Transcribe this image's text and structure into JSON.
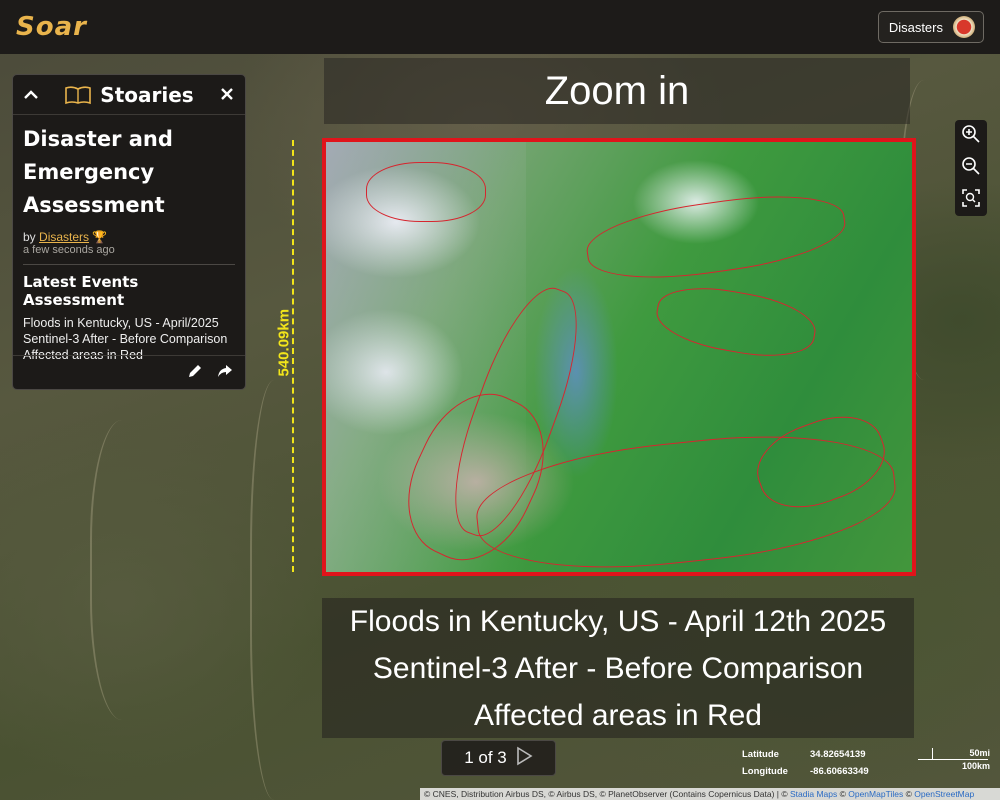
{
  "header": {
    "logo": "Soar",
    "category_button": {
      "label": "Disasters",
      "icon": "disasters-badge-icon"
    }
  },
  "panel": {
    "title": "Stoaries",
    "story_title_lines": [
      "Disaster and",
      "Emergency",
      "Assessment"
    ],
    "by_label": "by",
    "author": "Disasters",
    "timestamp": "a few seconds ago",
    "section_title": "Latest Events Assessment",
    "description_lines": [
      "Floods in Kentucky, US - April/2025",
      "Sentinel-3 After - Before Comparison",
      "Affected areas in Red"
    ]
  },
  "map": {
    "zoom_header": "Zoom in",
    "scale_label": "540.09km",
    "caption_lines": [
      "Floods in Kentucky, US - April 12th 2025",
      "Sentinel-3 After - Before Comparison",
      "Affected areas in Red"
    ],
    "highlight_color": "#e0141b",
    "scale_color": "#f2e51a"
  },
  "pagination": {
    "label": "1 of 3"
  },
  "coordinates": {
    "latitude_label": "Latitude",
    "latitude": "34.82654139",
    "longitude_label": "Longitude",
    "longitude": "-86.60663349"
  },
  "scalebar": {
    "top": "50mi",
    "bottom": "100km"
  },
  "attribution": {
    "text": "© CNES, Distribution Airbus DS, © Airbus DS, © PlanetObserver (Contains Copernicus Data) | © ",
    "links": [
      "Stadia Maps",
      "OpenMapTiles",
      "OpenStreetMap"
    ],
    "sep": " © "
  }
}
